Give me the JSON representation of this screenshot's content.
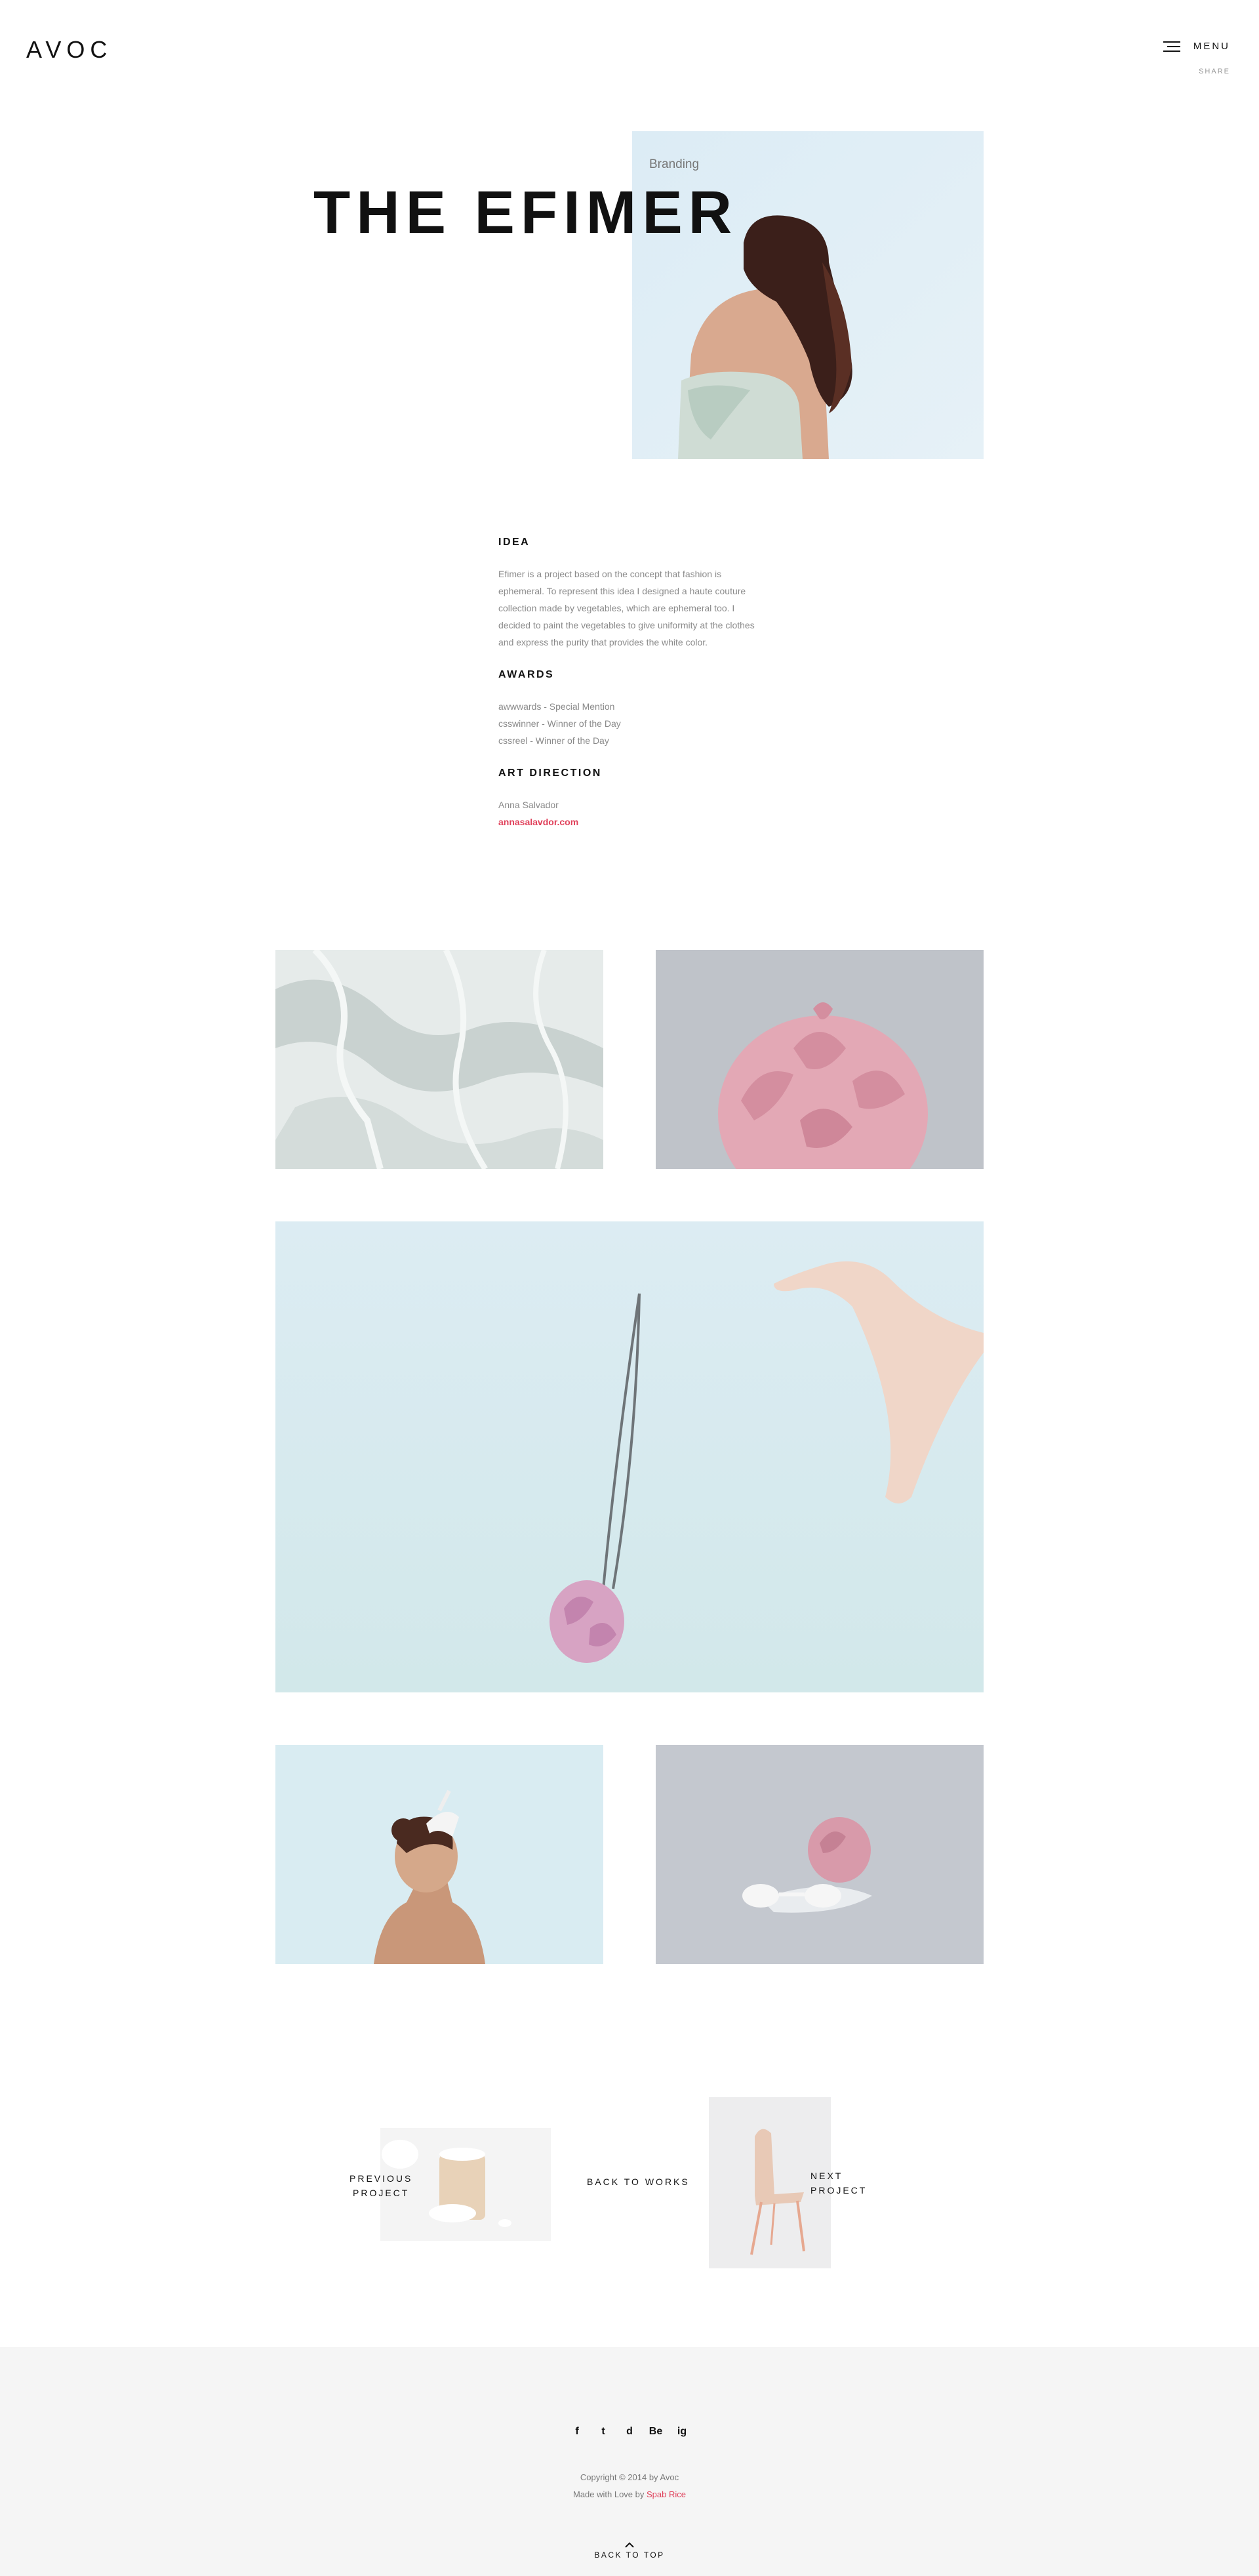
{
  "header": {
    "logo": "AVOC",
    "menu_label": "MENU",
    "share_label": "SHARE"
  },
  "hero": {
    "category": "Branding",
    "title": "THE EFIMER"
  },
  "info": {
    "idea_heading": "IDEA",
    "idea_text": "Efimer is a project based on the concept that fashion is ephemeral. To represent this idea I designed a haute couture collection made by vegetables, which are ephemeral too. I decided to paint the vegetables to give uniformity at the clothes and express the purity that provides the white color.",
    "awards_heading": "AWARDS",
    "awards": [
      "awwwards - Special Mention",
      "csswinner - Winner of the Day",
      "cssreel - Winner of the Day"
    ],
    "direction_heading": "ART DIRECTION",
    "director": "Anna Salvador",
    "director_link": "annasalavdor.com"
  },
  "project_nav": {
    "prev_line1": "PREVIOUS",
    "prev_line2": "PROJECT",
    "back": "BACK TO WORKS",
    "next_line1": "NEXT",
    "next_line2": "PROJECT"
  },
  "footer": {
    "socials": [
      "f",
      "t",
      "d",
      "Be",
      "ig"
    ],
    "social_names": [
      "facebook-icon",
      "twitter-icon",
      "dribbble-icon",
      "behance-icon",
      "instagram-icon"
    ],
    "copyright": "Copyright © 2014 by Avoc",
    "made_prefix": "Made with Love by",
    "made_author": "Spab Rice",
    "back_to_top": "BACK TO TOP"
  },
  "colors": {
    "accent": "#e0405a",
    "footer_bg": "#f5f5f5",
    "text_muted": "#8a8a8a"
  }
}
